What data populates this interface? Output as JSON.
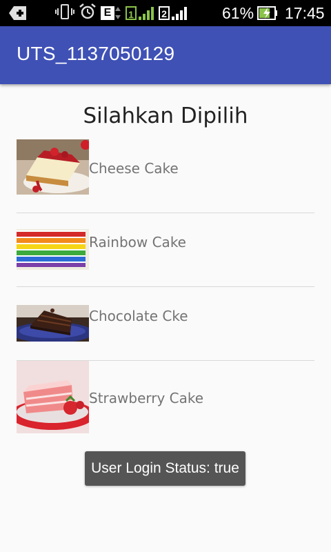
{
  "status_bar": {
    "battery_percent": "61%",
    "time": "17:45",
    "sim1_label": "1",
    "sim2_label": "2",
    "network_label": "E",
    "icons": [
      "usb-debug-icon",
      "vibrate-icon",
      "alarm-icon",
      "edge-network-icon",
      "sim1-signal-icon",
      "sim2-signal-icon",
      "battery-charging-icon"
    ]
  },
  "app_bar": {
    "title": "UTS_1137050129",
    "color": "#3f51b5"
  },
  "main": {
    "heading": "Silahkan Dipilih",
    "items": [
      {
        "label": "Cheese Cake",
        "image": "cheesecake-image"
      },
      {
        "label": "Rainbow Cake",
        "image": "rainbow-cake-image"
      },
      {
        "label": "Chocolate Cke",
        "image": "chocolate-cake-image"
      },
      {
        "label": "Strawberry Cake",
        "image": "strawberry-cake-image"
      }
    ]
  },
  "toast": {
    "text": "User Login Status: true"
  }
}
